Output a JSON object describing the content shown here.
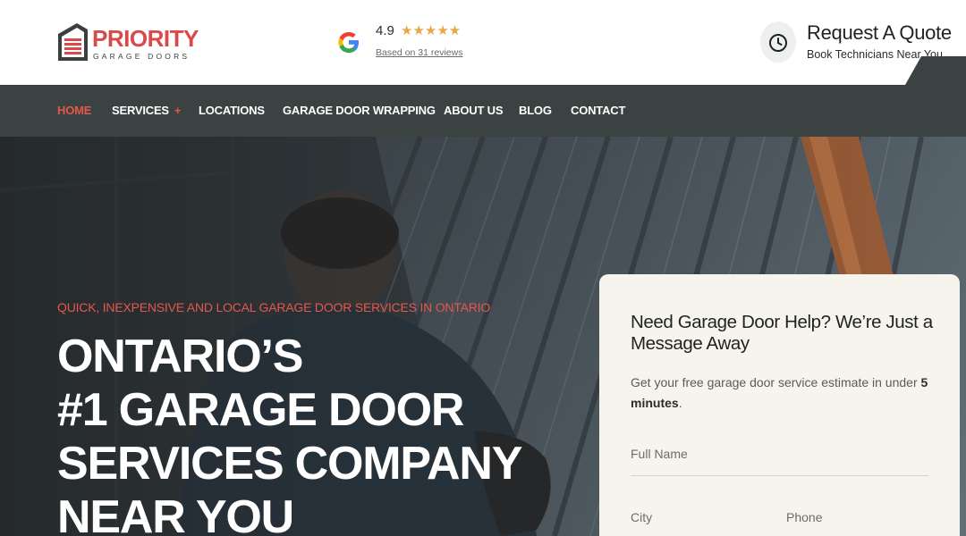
{
  "header": {
    "logo": {
      "name": "PRIORITY",
      "tagline": "GARAGE DOORS"
    },
    "rating": {
      "score": "4.9",
      "stars": "★★★★★",
      "reviews_text": "Based on 31 reviews"
    },
    "quote": {
      "title": "Request A Quote",
      "subtitle": "Book Technicians Near You"
    }
  },
  "nav": {
    "items": [
      {
        "label": "HOME"
      },
      {
        "label": "SERVICES"
      },
      {
        "label": "LOCATIONS"
      },
      {
        "label": "GARAGE DOOR WRAPPING"
      },
      {
        "label": "ABOUT US"
      },
      {
        "label": "BLOG"
      },
      {
        "label": "CONTACT"
      }
    ],
    "services_expand": "+"
  },
  "hero": {
    "tagline": "QUICK, INEXPENSIVE AND LOCAL GARAGE DOOR SERVICES IN ONTARIO",
    "title_lines": [
      "ONTARIO’S",
      "#1 GARAGE DOOR",
      "SERVICES COMPANY",
      "NEAR YOU"
    ]
  },
  "form": {
    "heading": "Need Garage Door Help? We’re Just a Message Away",
    "desc_prefix": "Get your free garage door service estimate in under ",
    "desc_bold": "5 minutes",
    "desc_suffix": ".",
    "fields": {
      "full_name": "Full Name",
      "city": "City",
      "phone": "Phone"
    }
  },
  "colors": {
    "accent": "#e5574d",
    "nav_bg": "#3a4242",
    "card_bg": "#f6f4ed",
    "star": "#e7a84a"
  },
  "icons": [
    "garage-logo-icon",
    "google-icon",
    "clock-icon"
  ]
}
